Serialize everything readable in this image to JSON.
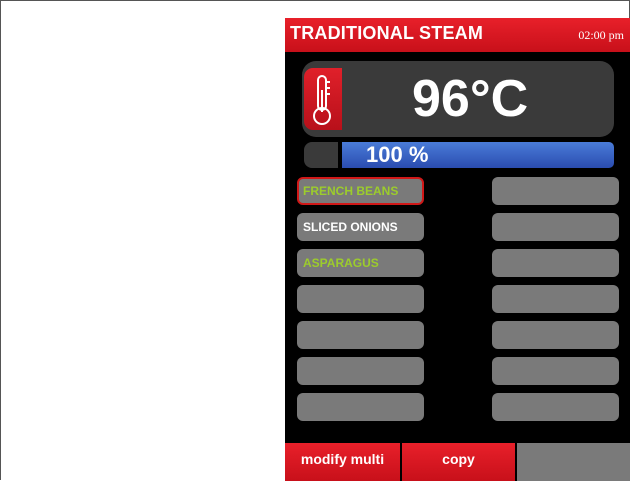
{
  "header": {
    "title": "TRADITIONAL STEAM",
    "time": "02:00 pm"
  },
  "temperature": {
    "value": "96°C",
    "icon": "thermometer-icon"
  },
  "progress": {
    "label": "100 %",
    "percent": 100
  },
  "left_slots": [
    {
      "label": "FRENCH BEANS",
      "selected": true,
      "color": "#9ccc2c"
    },
    {
      "label": "SLICED ONIONS",
      "selected": false,
      "color": "#ffffff"
    },
    {
      "label": "ASPARAGUS",
      "selected": false,
      "color": "#9ccc2c"
    },
    {
      "label": ""
    },
    {
      "label": ""
    },
    {
      "label": ""
    },
    {
      "label": ""
    }
  ],
  "right_slots": [
    {
      "label": ""
    },
    {
      "label": ""
    },
    {
      "label": ""
    },
    {
      "label": ""
    },
    {
      "label": ""
    },
    {
      "label": ""
    },
    {
      "label": ""
    }
  ],
  "footer": {
    "modify_multi": "modify multi",
    "copy": "copy"
  },
  "colors": {
    "accent_red": "#d01818",
    "progress_blue": "#3a64c8",
    "slot_gray": "#7a7a7a",
    "label_green": "#9ccc2c"
  }
}
